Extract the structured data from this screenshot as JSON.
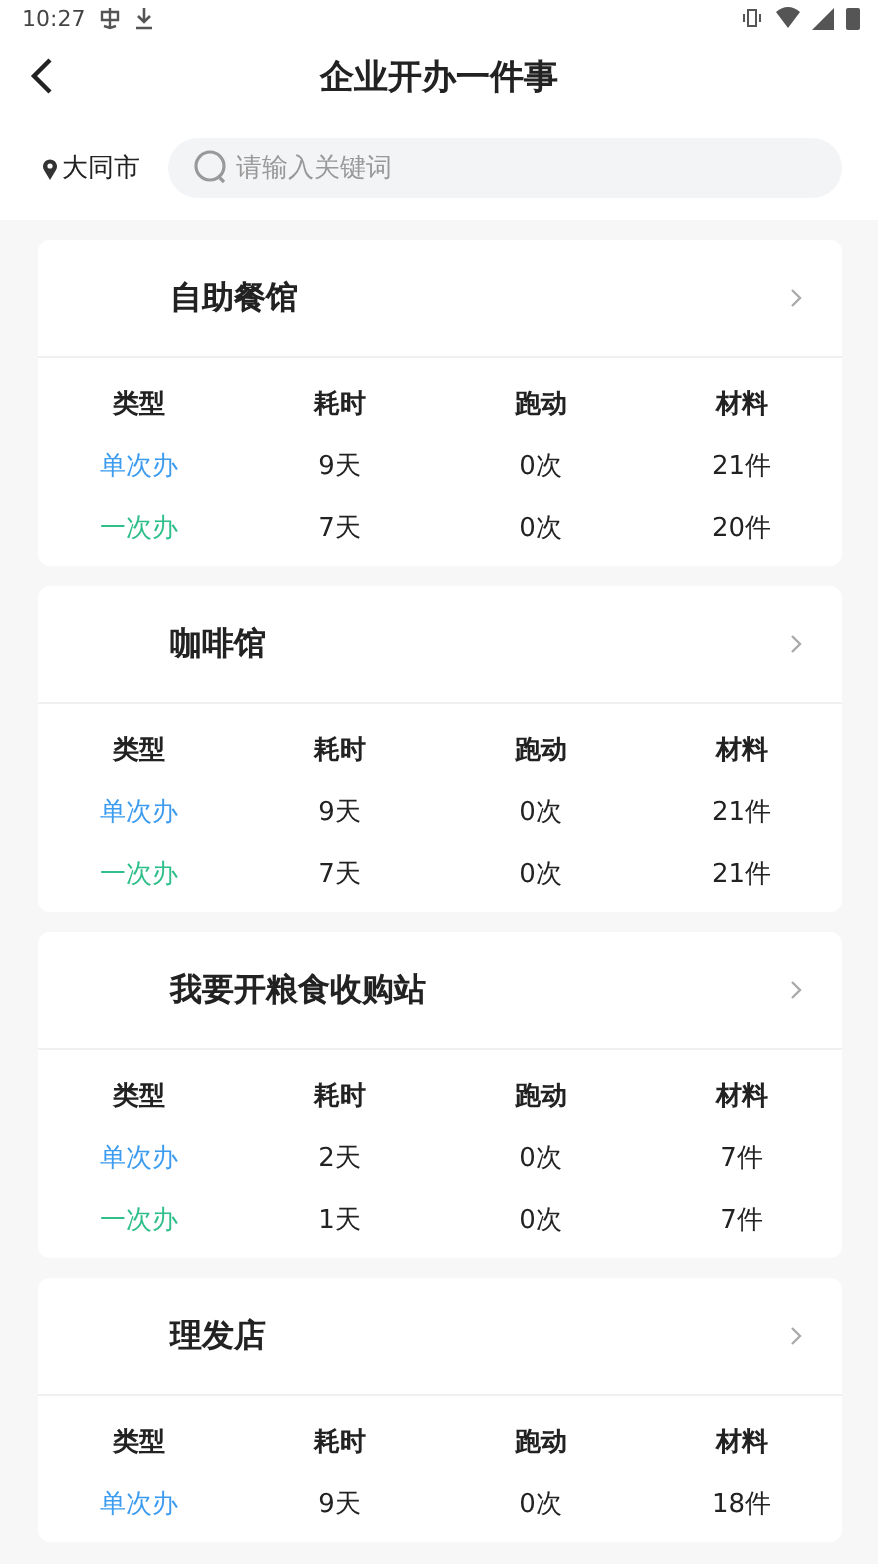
{
  "status_bar": {
    "time": "10:27"
  },
  "header": {
    "title": "企业开办一件事"
  },
  "search": {
    "city": "大同市",
    "placeholder": "请输入关键词"
  },
  "cards": [
    {
      "title": "自助餐馆",
      "columns": [
        "类型",
        "耗时",
        "跑动",
        "材料"
      ],
      "rows": [
        {
          "kind": "single",
          "type": "单次办",
          "time": "9天",
          "visits": "0次",
          "materials": "21件"
        },
        {
          "kind": "once",
          "type": "一次办",
          "time": "7天",
          "visits": "0次",
          "materials": "20件"
        }
      ]
    },
    {
      "title": "咖啡馆",
      "columns": [
        "类型",
        "耗时",
        "跑动",
        "材料"
      ],
      "rows": [
        {
          "kind": "single",
          "type": "单次办",
          "time": "9天",
          "visits": "0次",
          "materials": "21件"
        },
        {
          "kind": "once",
          "type": "一次办",
          "time": "7天",
          "visits": "0次",
          "materials": "21件"
        }
      ]
    },
    {
      "title": "我要开粮食收购站",
      "columns": [
        "类型",
        "耗时",
        "跑动",
        "材料"
      ],
      "rows": [
        {
          "kind": "single",
          "type": "单次办",
          "time": "2天",
          "visits": "0次",
          "materials": "7件"
        },
        {
          "kind": "once",
          "type": "一次办",
          "time": "1天",
          "visits": "0次",
          "materials": "7件"
        }
      ]
    },
    {
      "title": "理发店",
      "columns": [
        "类型",
        "耗时",
        "跑动",
        "材料"
      ],
      "rows": [
        {
          "kind": "single",
          "type": "单次办",
          "time": "9天",
          "visits": "0次",
          "materials": "18件"
        }
      ]
    }
  ]
}
